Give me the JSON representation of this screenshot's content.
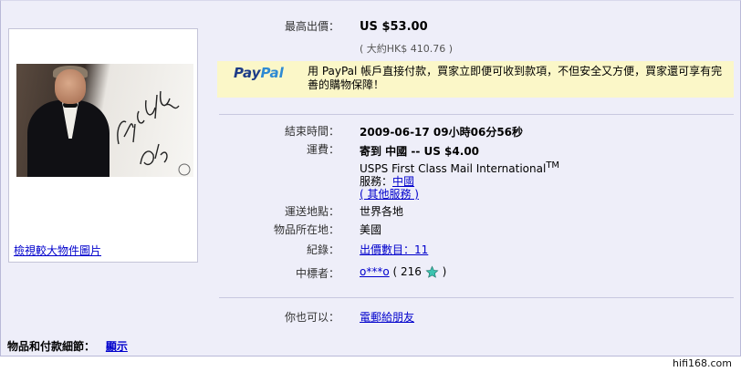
{
  "left": {
    "view_larger_link": "檢視較大物件圖片"
  },
  "photo_caption_handwriting": "Emil Gilels 1980",
  "bid": {
    "label": "最高出價：",
    "price": "US $53.00",
    "converted": "( 大約HK$ 410.76 )"
  },
  "paypal": {
    "logo_pay": "Pay",
    "logo_pal": "Pal",
    "message": "用 PayPal 帳戶直接付款，買家立即便可收到款項，不但安全又方便，買家還可享有完善的購物保障！"
  },
  "end_time": {
    "label": "結束時間：",
    "value": "2009-06-17 09小時06分56秒"
  },
  "shipping": {
    "label": "運費：",
    "line1": "寄到 中國 -- US $4.00",
    "service": "USPS First Class Mail International",
    "tm": "TM",
    "service_label": "服務：",
    "service_link": "中國",
    "other_services": "( 其他服務 )"
  },
  "ships_to": {
    "label": "運送地點：",
    "value": "世界各地"
  },
  "location": {
    "label": "物品所在地：",
    "value": "美國"
  },
  "history": {
    "label": "紀錄：",
    "link": "出價數目：11"
  },
  "winner": {
    "label": "中標者：",
    "user": "o***o",
    "feedback_open": "( 216",
    "feedback_close": ")",
    "star_color": "#3cc3b0"
  },
  "also": {
    "label": "你也可以：",
    "link": "電郵給朋友"
  },
  "bottom": {
    "label": "物品和付款細節：",
    "link": "顯示"
  },
  "watermark": "hifi168.com"
}
